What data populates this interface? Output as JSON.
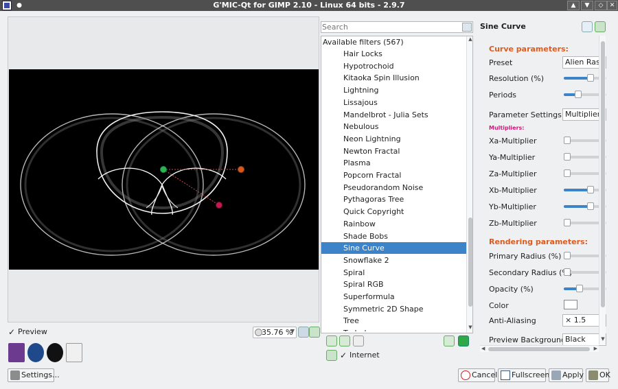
{
  "window": {
    "title": "G'MIC-Qt for GIMP 2.10 - Linux 64 bits - 2.9.7"
  },
  "preview": {
    "checkbox_checked": "✓",
    "label": "Preview",
    "zoom": "35.76 %"
  },
  "logos": [
    "GREYC",
    "CNRS",
    "UNICAEN",
    "ENSI CAEN"
  ],
  "settings_button": "Settings...",
  "search": {
    "placeholder": "Search"
  },
  "filters": {
    "header": "Available filters (567)",
    "items": [
      "Hair Locks",
      "Hypotrochoid",
      "Kitaoka Spin Illusion",
      "Lightning",
      "Lissajous",
      "Mandelbrot - Julia Sets",
      "Nebulous",
      "Neon Lightning",
      "Newton Fractal",
      "Plasma",
      "Popcorn Fractal",
      "Pseudorandom Noise",
      "Pythagoras Tree",
      "Quick Copyright",
      "Rainbow",
      "Shade Bobs",
      "Sine Curve",
      "Snowflake 2",
      "Spiral",
      "Spiral RGB",
      "Superformula",
      "Symmetric 2D Shape",
      "Tree",
      "Turbulence"
    ],
    "selected": "Sine Curve"
  },
  "internet": {
    "checkbox_checked": "✓",
    "label": "Internet"
  },
  "params": {
    "title": "Sine Curve",
    "curve_section": "Curve parameters:",
    "preset_label": "Preset",
    "preset_value": "Alien Rasta",
    "resolution_label": "Resolution (%)",
    "resolution_level": 0.65,
    "periods_label": "Periods",
    "periods_level": 0.3,
    "param_settings_label": "Parameter Settings",
    "param_settings_value": "Multipliers",
    "multipliers_section": "Multipliers:",
    "multipliers": [
      {
        "label": "Xa-Multiplier",
        "level": 0.0
      },
      {
        "label": "Ya-Multiplier",
        "level": 0.0
      },
      {
        "label": "Za-Multiplier",
        "level": 0.0
      },
      {
        "label": "Xb-Multiplier",
        "level": 0.65
      },
      {
        "label": "Yb-Multiplier",
        "level": 0.65
      },
      {
        "label": "Zb-Multiplier",
        "level": 0.0
      }
    ],
    "rendering_section": "Rendering parameters:",
    "primary_radius_label": "Primary Radius (%)",
    "primary_radius_level": 0.0,
    "secondary_radius_label": "Secondary Radius (%)",
    "secondary_radius_level": 0.0,
    "opacity_label": "Opacity (%)",
    "opacity_level": 0.35,
    "color_label": "Color",
    "color_value": "#ffffff",
    "antialiasing_label": "Anti-Aliasing",
    "antialiasing_value": "× 1.5",
    "preview_bg_label": "Preview Background",
    "preview_bg_value": "Black"
  },
  "buttons": {
    "cancel": "Cancel",
    "fullscreen": "Fullscreen",
    "apply": "Apply",
    "ok": "OK"
  },
  "colors": {
    "accent": "#3c84c7",
    "section_heading": "#e05a1d",
    "sub_heading": "#d11a7a",
    "titlebar": "#4f4f4f"
  }
}
